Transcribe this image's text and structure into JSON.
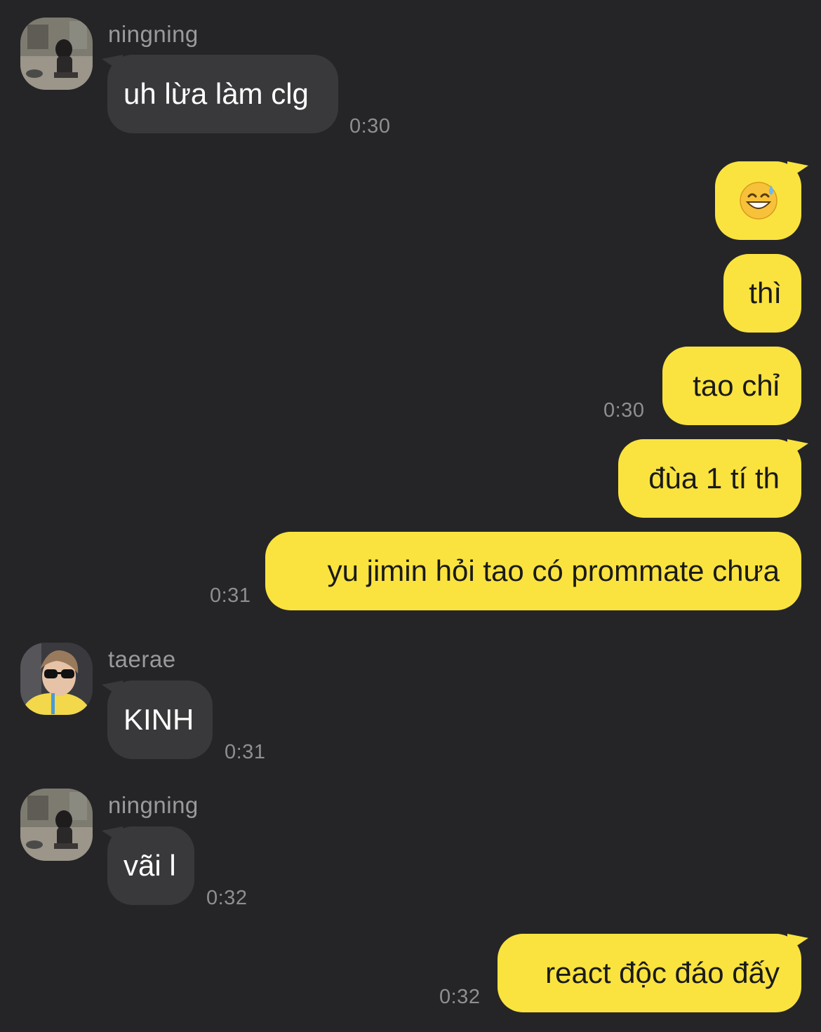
{
  "colors": {
    "background": "#252527",
    "incoming_bubble": "#39393b",
    "outgoing_bubble": "#fae33f",
    "timestamp": "#8e8e93",
    "sender_name": "#9a9a9e"
  },
  "messages": [
    {
      "sender": "ningning",
      "text": "uh lừa làm clg",
      "time": "0:30"
    },
    {
      "emoji_icon": "grinning-face-with-sweat-emoji"
    },
    {
      "text": "thì"
    },
    {
      "text": "tao chỉ",
      "time": "0:30"
    },
    {
      "text": "đùa 1 tí th"
    },
    {
      "text": "yu jimin hỏi tao có prommate chưa",
      "time": "0:31"
    },
    {
      "sender": "taerae",
      "text": "KINH",
      "time": "0:31"
    },
    {
      "sender": "ningning",
      "text": "vãi l",
      "time": "0:32"
    },
    {
      "text": "react độc đáo đấy",
      "time": "0:32"
    }
  ]
}
